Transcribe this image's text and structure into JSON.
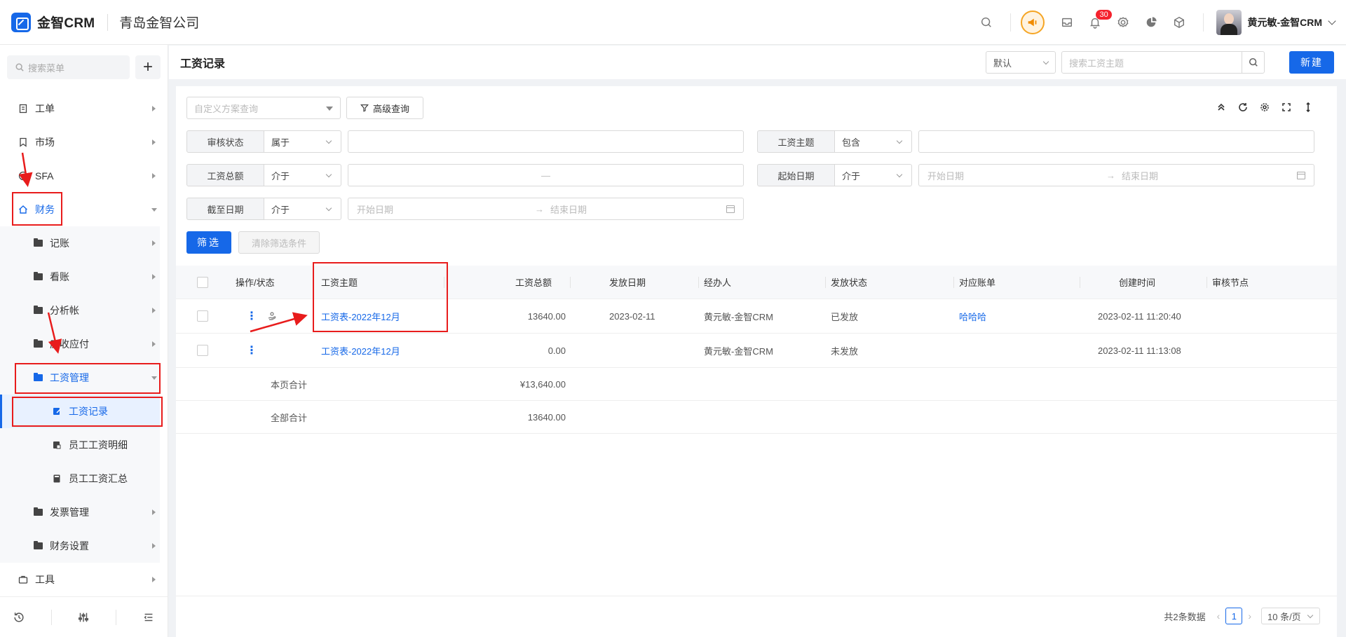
{
  "app": {
    "logo_text": "金智CRM",
    "company": "青岛金智公司"
  },
  "user": {
    "name": "黄元敏-金智CRM"
  },
  "notifications": {
    "count": "30"
  },
  "sidebar": {
    "search_placeholder": "搜索菜单",
    "add_label": "+",
    "items": [
      {
        "label": "工单"
      },
      {
        "label": "市场"
      },
      {
        "label": "SFA"
      },
      {
        "label": "财务"
      },
      {
        "label": "记账"
      },
      {
        "label": "看账"
      },
      {
        "label": "分析帐"
      },
      {
        "label": "应收应付"
      },
      {
        "label": "工资管理"
      },
      {
        "label": "工资记录"
      },
      {
        "label": "员工工资明细"
      },
      {
        "label": "员工工资汇总"
      },
      {
        "label": "发票管理"
      },
      {
        "label": "财务设置"
      },
      {
        "label": "工具"
      }
    ]
  },
  "header": {
    "title": "工资记录",
    "view_select": "默认",
    "search_placeholder": "搜索工资主题",
    "new_label": "新建"
  },
  "filters": {
    "scheme_placeholder": "自定义方案查询",
    "advanced_label": "高级查询",
    "rows": [
      {
        "label": "审核状态",
        "op": "属于"
      },
      {
        "label": "工资主题",
        "op": "包含"
      },
      {
        "label": "工资总额",
        "op": "介于",
        "range_sep": "—"
      },
      {
        "label": "起始日期",
        "op": "介于",
        "start": "开始日期",
        "end": "结束日期"
      },
      {
        "label": "截至日期",
        "op": "介于",
        "start": "开始日期",
        "end": "结束日期"
      }
    ],
    "date_arrow": "→",
    "filter_label": "筛选",
    "clear_label": "清除筛选条件"
  },
  "table": {
    "headers": [
      "操作/状态",
      "工资主题",
      "工资总额",
      "发放日期",
      "经办人",
      "发放状态",
      "对应账单",
      "创建时间",
      "审核节点"
    ],
    "rows": [
      {
        "subject": "工资表-2022年12月",
        "total": "13640.00",
        "pay_date": "2023-02-11",
        "handler": "黄元敏-金智CRM",
        "status": "已发放",
        "bill": "哈哈哈",
        "created": "2023-02-11 11:20:40",
        "node": ""
      },
      {
        "subject": "工资表-2022年12月",
        "total": "0.00",
        "pay_date": "",
        "handler": "黄元敏-金智CRM",
        "status": "未发放",
        "bill": "",
        "created": "2023-02-11 11:13:08",
        "node": ""
      }
    ],
    "page_total_label": "本页合计",
    "page_total_value": "¥13,640.00",
    "all_total_label": "全部合计",
    "all_total_value": "13640.00",
    "row_menu": "⋮"
  },
  "pager": {
    "summary": "共2条数据",
    "prev": "‹",
    "page": "1",
    "next": "›",
    "size": "10 条/页"
  },
  "colors": {
    "accent": "#1668e8",
    "annotation": "#e81c1c"
  }
}
